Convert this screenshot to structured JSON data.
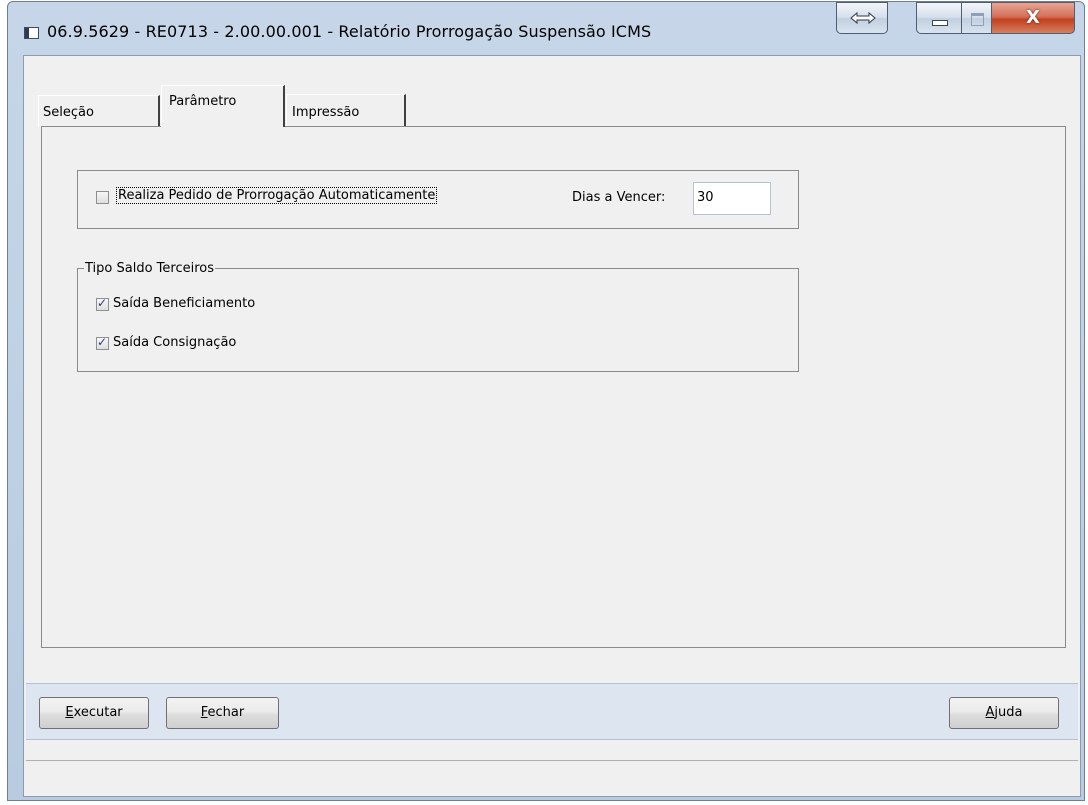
{
  "window": {
    "title": "06.9.5629 - RE0713 - 2.00.00.001 - Relatório Prorrogação Suspensão ICMS",
    "close_glyph": "X"
  },
  "tabs": [
    {
      "label": "Seleção"
    },
    {
      "label": "Parâmetro"
    },
    {
      "label": "Impressão"
    }
  ],
  "params": {
    "auto_extension_label": "Realiza Pedido de Prorrogação Automaticamente",
    "auto_extension_checked": false,
    "days_label": "Dias a Vencer:",
    "days_value": "30"
  },
  "balance_type": {
    "legend": "Tipo Saldo Terceiros",
    "options": [
      {
        "label": "Saída Beneficiamento",
        "checked": true
      },
      {
        "label": "Saída Consignação",
        "checked": true
      }
    ]
  },
  "buttons": {
    "execute": {
      "mnemonic": "E",
      "rest": "xecutar"
    },
    "close": {
      "mnemonic": "F",
      "rest": "echar"
    },
    "help": {
      "mnemonic": "A",
      "rest": "juda"
    }
  }
}
